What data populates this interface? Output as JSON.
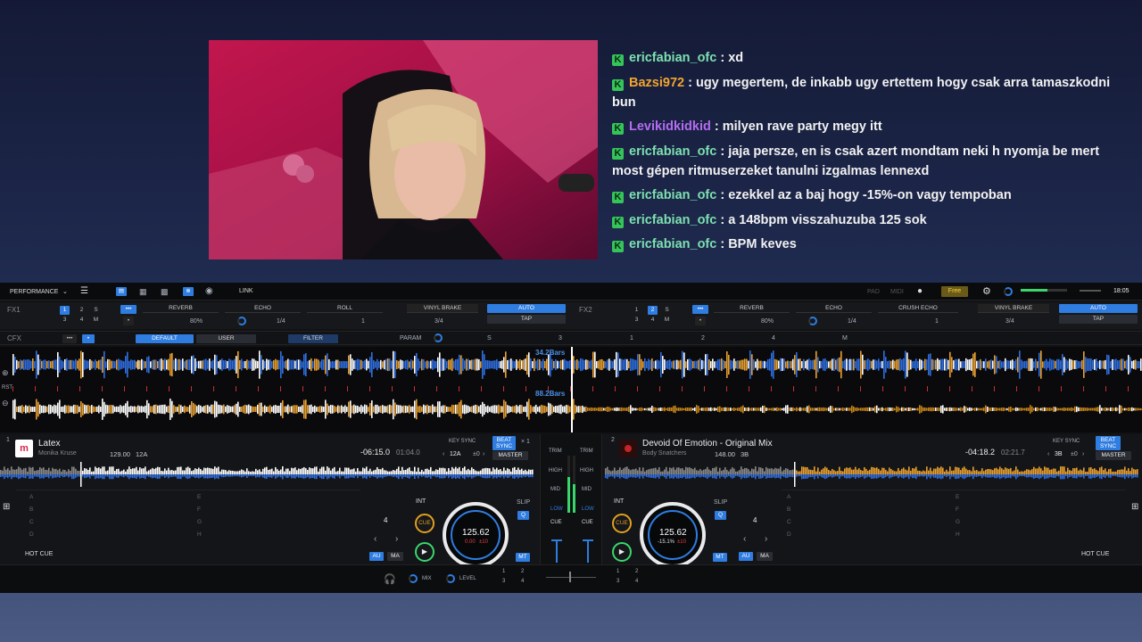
{
  "chat": [
    {
      "user": "ericfabian_ofc",
      "color": "#7de0b0",
      "text": " : xd"
    },
    {
      "user": "Bazsi972",
      "color": "#f0a530",
      "text": " : ugy megertem, de inkabb ugy ertettem hogy csak arra tamaszkodni bun"
    },
    {
      "user": "Levikidkidkid",
      "color": "#b46cf0",
      "text": " : milyen rave party megy itt"
    },
    {
      "user": "ericfabian_ofc",
      "color": "#7de0b0",
      "text": " : jaja persze, en is csak azert mondtam neki h nyomja be mert most gépen ritmuserzeket tanulni izgalmas lennexd"
    },
    {
      "user": "ericfabian_ofc",
      "color": "#7de0b0",
      "text": " : ezekkel az a baj hogy -15%-on vagy tempoban"
    },
    {
      "user": "ericfabian_ofc",
      "color": "#7de0b0",
      "text": " : a 148bpm visszahuzuba 125 sok"
    },
    {
      "user": "ericfabian_ofc",
      "color": "#7de0b0",
      "text": " : BPM keves"
    }
  ],
  "topbar": {
    "mode": "PERFORMANCE",
    "link": "LINK",
    "pad": "PAD",
    "midi": "MIDI",
    "free": "Free",
    "clock": "18:05"
  },
  "fx1": {
    "label": "FX1",
    "nums": [
      "1",
      "2",
      "S",
      "3",
      "4",
      "M"
    ],
    "slots": [
      "REVERB",
      "ECHO",
      "ROLL"
    ],
    "slot_vals": [
      "80%",
      "1/4",
      "1"
    ],
    "brake": "VINYL BRAKE",
    "brake_val": "3/4",
    "auto": "AUTO",
    "tap": "TAP"
  },
  "fx2": {
    "label": "FX2",
    "nums": [
      "1",
      "2",
      "S",
      "3",
      "4",
      "M"
    ],
    "slots": [
      "REVERB",
      "ECHO",
      "CRUSH ECHO"
    ],
    "slot_vals": [
      "80%",
      "1/4",
      "1"
    ],
    "brake": "VINYL BRAKE",
    "brake_val": "3/4",
    "auto": "AUTO",
    "tap": "TAP"
  },
  "cfx": {
    "label": "CFX",
    "default": "DEFAULT",
    "user": "USER",
    "filter": "FILTER",
    "param": "PARAM",
    "s": "S",
    "n3": "3",
    "n1": "1",
    "n2": "2",
    "n4": "4",
    "m": "M"
  },
  "waveform": {
    "bars_top": "34.2Bars",
    "bars_bottom": "88.2Bars",
    "rst": "RST"
  },
  "deck1": {
    "num": "1",
    "title": "Latex",
    "artist": "Monika Kruse",
    "bpm": "129.00",
    "key": "12A",
    "remain": "-06:15.0",
    "elapsed": "01:04.0",
    "keysync": "KEY SYNC",
    "beat": "BEAT",
    "sync": "SYNC",
    "x1": "× 1",
    "key_val": "12A",
    "key_shift": "±0",
    "master": "MASTER",
    "jog_bpm": "125.62",
    "jog_pitch": "0.00",
    "jog_range": "±10",
    "hotcue": "HOT CUE",
    "loop": "4",
    "int": "INT",
    "cue": "CUE",
    "slip": "SLIP",
    "q": "Q",
    "au": "AU",
    "ma": "MA",
    "mt": "MT",
    "pads_left": [
      "A",
      "B",
      "C",
      "D"
    ],
    "pads_right": [
      "E",
      "F",
      "G",
      "H"
    ]
  },
  "deck2": {
    "num": "2",
    "title": "Devoid Of Emotion - Original Mix",
    "artist": "Body Snatchers",
    "bpm": "148.00",
    "key": "3B",
    "remain": "-04:18.2",
    "elapsed": "02:21.7",
    "keysync": "KEY SYNC",
    "beat": "BEAT",
    "sync": "SYNC",
    "key_val": "3B",
    "key_shift": "±0",
    "master": "MASTER",
    "jog_bpm": "125.62",
    "jog_pitch": "-15.1%",
    "jog_range": "±10",
    "hotcue": "HOT CUE",
    "loop": "4",
    "int": "INT",
    "cue": "CUE",
    "slip": "SLIP",
    "q": "Q",
    "au": "AU",
    "ma": "MA",
    "mt": "MT",
    "pads_left": [
      "A",
      "B",
      "C",
      "D"
    ],
    "pads_right": [
      "E",
      "F",
      "G",
      "H"
    ]
  },
  "mixer": {
    "trim": "TRIM",
    "high": "HIGH",
    "mid": "MID",
    "low": "LOW",
    "cue": "CUE",
    "mix": "MIX",
    "level": "LEVEL",
    "nums": [
      "1",
      "2",
      "3",
      "4"
    ]
  }
}
